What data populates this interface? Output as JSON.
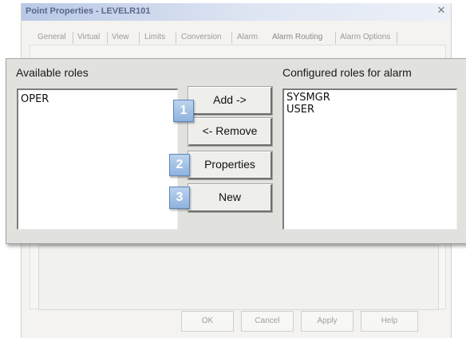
{
  "window": {
    "title": "Point Properties - LEVELR101",
    "close_icon": "close-icon"
  },
  "tabs": [
    {
      "label": "General"
    },
    {
      "label": "Virtual"
    },
    {
      "label": "View"
    },
    {
      "label": "Limits"
    },
    {
      "label": "Conversion"
    },
    {
      "label": "Alarm"
    },
    {
      "label": "Alarm Routing",
      "active": true
    },
    {
      "label": "Alarm Options"
    }
  ],
  "roles_panel": {
    "available_label": "Available roles",
    "configured_label": "Configured roles for alarm",
    "available_roles": [
      "OPER"
    ],
    "configured_roles": [
      "SYSMGR",
      "USER"
    ],
    "add_label": "Add ->",
    "remove_label": "<- Remove",
    "properties_label": "Properties",
    "new_label": "New"
  },
  "callouts": [
    "1",
    "2",
    "3"
  ],
  "footer": {
    "ok_label": "OK",
    "cancel_label": "Cancel",
    "apply_label": "Apply",
    "help_label": "Help"
  },
  "colors": {
    "callout_fill": "#9fbfe4",
    "panel_bg": "#e1e1de",
    "title_gradient_start": "#b9c8e6"
  }
}
